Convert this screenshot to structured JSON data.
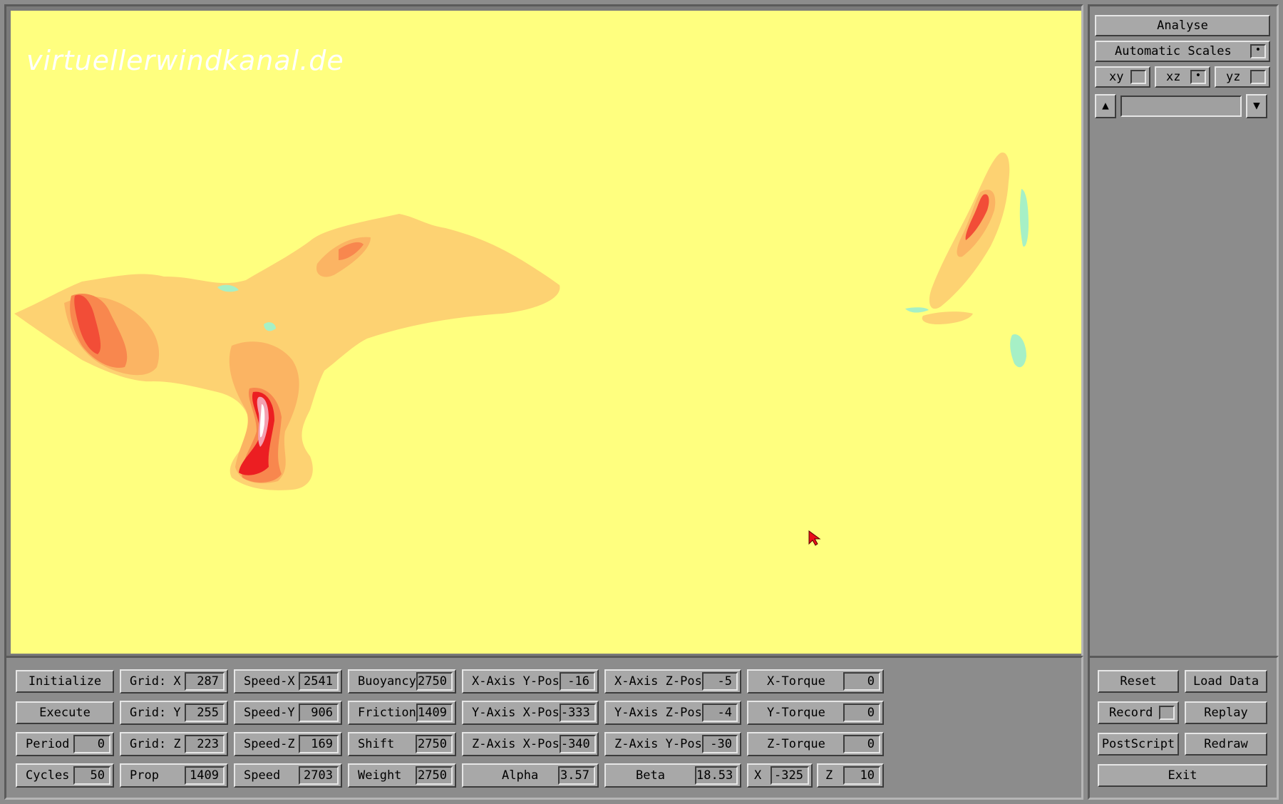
{
  "watermark": "virtuellerwindkanal.de",
  "side": {
    "analyse_label": "Analyse",
    "scales_label": "Automatic Scales",
    "scales_checked": "•",
    "planes": [
      {
        "label": "xy",
        "checked": ""
      },
      {
        "label": "xz",
        "checked": "•"
      },
      {
        "label": "yz",
        "checked": ""
      }
    ],
    "up_arrow": "▲",
    "down_arrow": "▼"
  },
  "controls": {
    "initialize": "Initialize",
    "execute": "Execute",
    "period_label": "Period",
    "period_value": "0",
    "cycles_label": "Cycles",
    "cycles_value": "50",
    "grid_x_label": "Grid: X",
    "grid_x_value": "287",
    "grid_y_label": "Grid: Y",
    "grid_y_value": "255",
    "grid_z_label": "Grid: Z",
    "grid_z_value": "223",
    "prop_label": "Prop",
    "prop_value": "1409",
    "speed_x_label": "Speed-X",
    "speed_x_value": "2541",
    "speed_y_label": "Speed-Y",
    "speed_y_value": "906",
    "speed_z_label": "Speed-Z",
    "speed_z_value": "169",
    "speed_label": "Speed",
    "speed_value": "2703",
    "buoyancy_label": "Buoyancy",
    "buoyancy_value": "2750",
    "friction_label": "Friction",
    "friction_value": "1409",
    "shift_label": "Shift",
    "shift_value": "2750",
    "weight_label": "Weight",
    "weight_value": "2750",
    "xaxis_ypos_label": "X-Axis Y-Pos",
    "xaxis_ypos_value": "-16",
    "yaxis_xpos_label": "Y-Axis X-Pos",
    "yaxis_xpos_value": "-333",
    "zaxis_xpos_label": "Z-Axis X-Pos",
    "zaxis_xpos_value": "-340",
    "alpha_label": "Alpha",
    "alpha_value": "3.57",
    "xaxis_zpos_label": "X-Axis Z-Pos",
    "xaxis_zpos_value": "-5",
    "yaxis_zpos_label": "Y-Axis Z-Pos",
    "yaxis_zpos_value": "-4",
    "zaxis_ypos_label": "Z-Axis Y-Pos",
    "zaxis_ypos_value": "-30",
    "beta_label": "Beta",
    "beta_value": "18.53",
    "xtorque_label": "X-Torque",
    "xtorque_value": "0",
    "ytorque_label": "Y-Torque",
    "ytorque_value": "0",
    "ztorque_label": "Z-Torque",
    "ztorque_value": "0",
    "x_label": "X",
    "x_value": "-325",
    "z_label": "Z",
    "z_value": "10"
  },
  "actions": {
    "reset": "Reset",
    "load_data": "Load Data",
    "record": "Record",
    "record_checked": "",
    "replay": "Replay",
    "postscript": "PostScript",
    "redraw": "Redraw",
    "exit": "Exit"
  },
  "colors": {
    "background": "#ffff7f",
    "level_1": "#fdd272",
    "level_2": "#fbb463",
    "level_3": "#f8874e",
    "level_4": "#f24d37",
    "level_5": "#ec1e22",
    "level_6": "#f4a0b0",
    "negative": "#a6f0c6"
  }
}
